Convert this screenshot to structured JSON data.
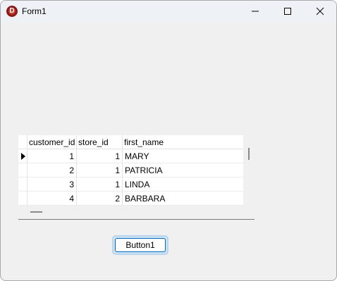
{
  "window": {
    "title": "Form1",
    "app_icon_letter": "D",
    "controls": {
      "minimize": "minimize-icon",
      "maximize": "maximize-icon",
      "close": "close-icon"
    }
  },
  "grid": {
    "columns": [
      "customer_id",
      "store_id",
      "first_name"
    ],
    "rows": [
      {
        "customer_id": "1",
        "store_id": "1",
        "first_name": "MARY",
        "current": true
      },
      {
        "customer_id": "2",
        "store_id": "1",
        "first_name": "PATRICIA"
      },
      {
        "customer_id": "3",
        "store_id": "1",
        "first_name": "LINDA"
      },
      {
        "customer_id": "4",
        "store_id": "2",
        "first_name": "BARBARA"
      }
    ]
  },
  "button1": {
    "label": "Button1"
  },
  "colors": {
    "accent": "#0067c0",
    "window_bg": "#f0f0f0",
    "titlebar_bg": "#eef2f7"
  }
}
